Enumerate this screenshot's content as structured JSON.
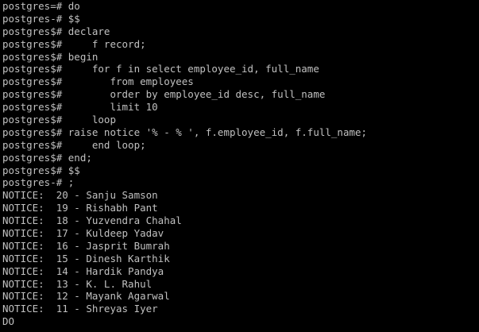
{
  "terminal": {
    "lines": [
      "postgres=# do",
      "postgres-# $$",
      "postgres$# declare",
      "postgres$#     f record;",
      "postgres$# begin",
      "postgres$#     for f in select employee_id, full_name",
      "postgres$#        from employees",
      "postgres$#        order by employee_id desc, full_name",
      "postgres$#        limit 10",
      "postgres$#     loop",
      "postgres$# raise notice '% - % ', f.employee_id, f.full_name;",
      "postgres$#     end loop;",
      "postgres$# end;",
      "postgres$# $$",
      "postgres-# ;",
      "NOTICE:  20 - Sanju Samson",
      "NOTICE:  19 - Rishabh Pant",
      "NOTICE:  18 - Yuzvendra Chahal",
      "NOTICE:  17 - Kuldeep Yadav",
      "NOTICE:  16 - Jasprit Bumrah",
      "NOTICE:  15 - Dinesh Karthik",
      "NOTICE:  14 - Hardik Pandya",
      "NOTICE:  13 - K. L. Rahul",
      "NOTICE:  12 - Mayank Agarwal",
      "NOTICE:  11 - Shreyas Iyer",
      "DO"
    ]
  },
  "colors": {
    "background": "#000000",
    "foreground": "#c0c0c0"
  }
}
